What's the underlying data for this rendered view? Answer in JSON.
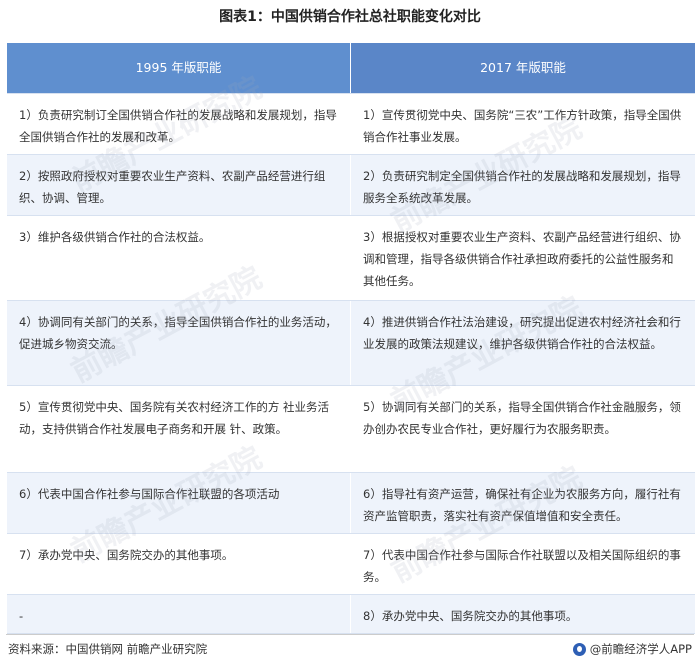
{
  "title": "图表1：中国供销合作社总社职能变化对比",
  "headers": {
    "left": "1995 年版职能",
    "right": "2017 年版职能"
  },
  "rows": [
    {
      "left": "1）负责研究制订全国供销合作社的发展战略和发展规划，指导全国供销合作社的发展和改革。",
      "right": "1）宣传贯彻党中央、国务院“三农”工作方针政策，指导全国供销合作社事业发展。"
    },
    {
      "left": "2）按照政府授权对重要农业生产资料、农副产品经营进行组织、协调、管理。",
      "right": "2）负责研究制定全国供销合作社的发展战略和发展规划，指导服务全系统改革发展。"
    },
    {
      "left": "3）维护各级供销合作社的合法权益。",
      "right": "3）根据授权对重要农业生产资料、农副产品经营进行组织、协调和管理，指导各级供销合作社承担政府委托的公益性服务和其他任务。"
    },
    {
      "left": "4）协调同有关部门的关系，指导全国供销合作社的业务活动，促进城乡物资交流。",
      "right": "4）推进供销合作社法治建设，研究提出促进农村经济社会和行业发展的政策法规建议，维护各级供销合作社的合法权益。"
    },
    {
      "left": "5）宣传贯彻党中央、国务院有关农村经济工作的方 社业务活动，支持供销合作社发展电子商务和开展 针、政策。",
      "right": "5）协调同有关部门的关系，指导全国供销合作社金融服务，领办创办农民专业合作社，更好履行为农服务职责。"
    },
    {
      "left": "6）代表中国合作社参与国际合作社联盟的各项活动",
      "right": "6）指导社有资产运营，确保社有企业为农服务方向，履行社有资产监管职责，落实社有资产保值增值和安全责任。"
    },
    {
      "left": "7）承办党中央、国务院交办的其他事项。",
      "right": "7）代表中国合作社参与国际合作社联盟以及相关国际组织的事务。"
    },
    {
      "left": "-",
      "right": "8）承办党中央、国务院交办的其他事项。"
    }
  ],
  "footer": {
    "source": "资料来源：中国供销网 前瞻产业研究院",
    "brand": "@前瞻经济学人APP"
  },
  "watermark": "前瞻产业研究院",
  "colors": {
    "header_bg": "#5b87c9",
    "stripe": "#eef3fb",
    "brand_icon": "#2e5fb5"
  }
}
